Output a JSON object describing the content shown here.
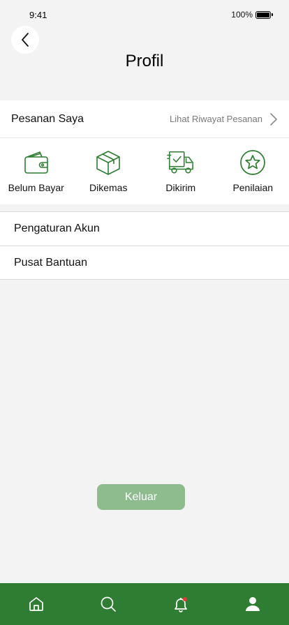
{
  "status_bar": {
    "time": "9:41",
    "battery": "100%"
  },
  "header": {
    "title": "Profil",
    "back_icon": "chevron-left-icon"
  },
  "orders": {
    "title": "Pesanan Saya",
    "history_link": "Lihat Riwayat Pesanan",
    "statuses": [
      {
        "label": "Belum Bayar",
        "icon": "wallet-icon"
      },
      {
        "label": "Dikemas",
        "icon": "box-icon"
      },
      {
        "label": "Dikirim",
        "icon": "truck-icon"
      },
      {
        "label": "Penilaian",
        "icon": "star-icon"
      }
    ]
  },
  "menu": [
    {
      "label": "Pengaturan Akun"
    },
    {
      "label": "Pusat Bantuan"
    }
  ],
  "logout_label": "Keluar",
  "bottom_nav": [
    {
      "icon": "home-icon"
    },
    {
      "icon": "search-icon"
    },
    {
      "icon": "bell-icon",
      "badge": true
    },
    {
      "icon": "user-icon",
      "active": true
    }
  ],
  "colors": {
    "accent": "#2e7d32",
    "logout_bg": "#8fbc8f",
    "background": "#f3f3f3"
  }
}
